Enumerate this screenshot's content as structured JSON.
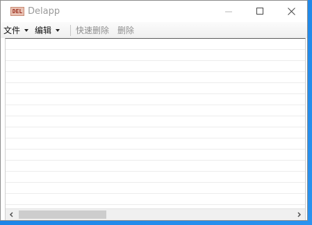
{
  "window": {
    "app_icon_text": "DEL",
    "title": "Delapp"
  },
  "titlebar_buttons": {
    "minimize_icon": "minimize-icon",
    "maximize_icon": "maximize-icon",
    "close_icon": "close-icon"
  },
  "menu": {
    "file_label": "文件",
    "edit_label": "编辑",
    "quick_delete_label": "快速删除",
    "delete_label": "删除"
  },
  "list": {
    "rows": [
      "",
      "",
      "",
      "",
      "",
      "",
      "",
      "",
      "",
      "",
      "",
      "",
      "",
      "",
      ""
    ]
  },
  "scrollbar": {
    "left_icon": "chevron-left-icon",
    "right_icon": "chevron-right-icon",
    "thumb_position": 0.0
  },
  "colors": {
    "desktop": "#1d86e8",
    "disabled_text": "#8e8e8e",
    "title_text": "#9a9a9a"
  }
}
